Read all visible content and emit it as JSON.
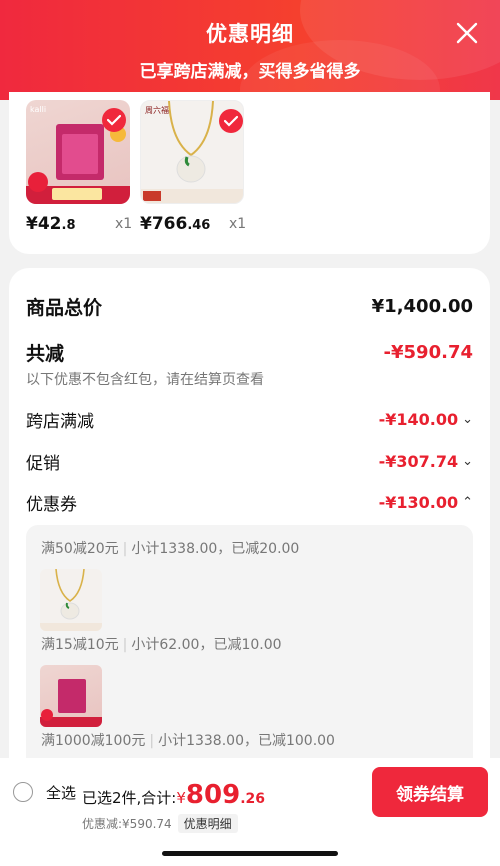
{
  "header": {
    "title": "优惠明细",
    "subtitle": "已享跨店满减，买得多省得多"
  },
  "products": [
    {
      "price_int": "¥42",
      "price_dec": ".8",
      "qty": "x1",
      "brand": "kalli"
    },
    {
      "price_int": "¥766",
      "price_dec": ".46",
      "qty": "x1",
      "brand": "周六福"
    }
  ],
  "summary": {
    "total_label": "商品总价",
    "total_value": "¥1,400.00",
    "saved_label": "共减",
    "saved_value": "-¥590.74",
    "note": "以下优惠不包含红包，请在结算页查看",
    "items": [
      {
        "label": "跨店满减",
        "value": "-¥140.00",
        "chevron": "chevron-down"
      },
      {
        "label": "促销",
        "value": "-¥307.74",
        "chevron": "chevron-down"
      },
      {
        "label": "优惠券",
        "value": "-¥130.00",
        "chevron": "chevron-up"
      }
    ]
  },
  "coupons": [
    {
      "rule": "满50减20元",
      "detail": "小计1338.00，已减20.00"
    },
    {
      "rule": "满15减10元",
      "detail": "小计62.00，已减10.00"
    },
    {
      "rule": "满1000减100元",
      "detail": "小计1338.00，已减100.00"
    }
  ],
  "bottom": {
    "select_all": "全选",
    "selected_text": "已选2件,合计:",
    "total_yen": "¥",
    "total_int": "809",
    "total_dec": ".26",
    "discount_text": "优惠减:¥590.74",
    "detail_tag": "优惠明细",
    "checkout": "领券结算"
  },
  "colors": {
    "accent": "#ef283c",
    "header": "#f0293e"
  }
}
